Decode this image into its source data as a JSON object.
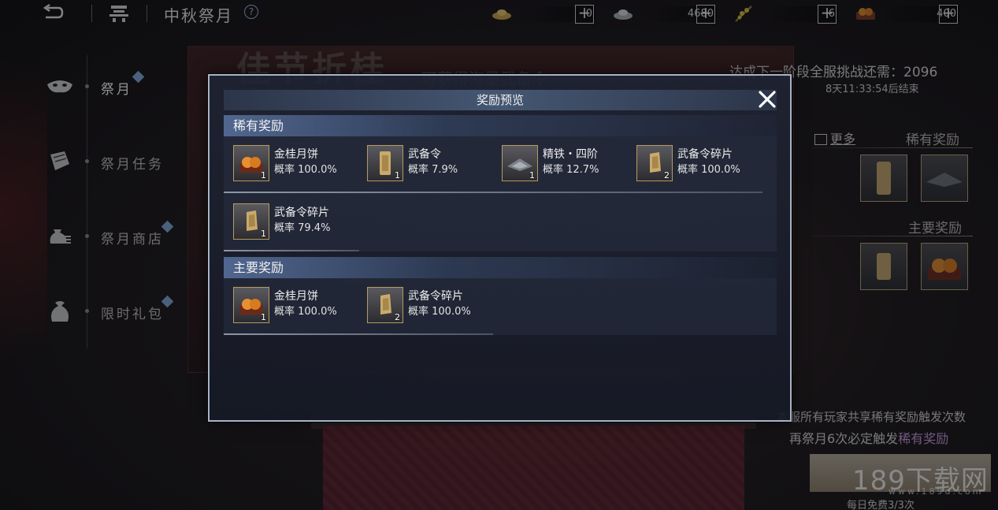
{
  "header": {
    "title": "中秋祭月",
    "currencies": [
      {
        "icon": "gold-ingot-icon",
        "value": "0"
      },
      {
        "icon": "silver-ingot-icon",
        "value": "4680"
      },
      {
        "icon": "osmanthus-branch-icon",
        "value": "6"
      },
      {
        "icon": "mooncake-currency-icon",
        "value": "400"
      }
    ]
  },
  "background": {
    "banner_title": "佳节折桂",
    "banner_sub": "可获得海量武备令"
  },
  "sidebar": {
    "items": [
      {
        "label": "祭月",
        "icon": "mask-icon",
        "active": true,
        "badge": true
      },
      {
        "label": "祭月任务",
        "icon": "scroll-icon",
        "active": false,
        "badge": false
      },
      {
        "label": "祭月商店",
        "icon": "money-bag-icon",
        "active": false,
        "badge": true
      },
      {
        "label": "限时礼包",
        "icon": "gift-bag-icon",
        "active": false,
        "badge": true
      }
    ]
  },
  "right_panel": {
    "challenge": "达成下一阶段全服挑战还需：2096",
    "countdown": "8天11:33:54后结束",
    "more": "更多",
    "rare_title": "稀有奖励",
    "main_title": "主要奖励",
    "share_text": "本服所有玩家共享稀有奖励触发次数",
    "trigger_prefix": "再祭月6次必定触发",
    "trigger_highlight": "稀有奖励",
    "daily_free": "每日免费3/3次"
  },
  "watermark": {
    "text": "189下载网",
    "url": "www.189d.com"
  },
  "modal": {
    "title": "奖励预览",
    "rare_section": {
      "title": "稀有奖励",
      "items": [
        {
          "name": "金桂月饼",
          "prob": "概率 100.0%",
          "qty": "1",
          "icon": "mooncake-icon"
        },
        {
          "name": "武备令",
          "prob": "概率 7.9%",
          "qty": "1",
          "icon": "token-icon"
        },
        {
          "name": "精铁・四阶",
          "prob": "概率 12.7%",
          "qty": "1",
          "icon": "iron-ore-icon"
        },
        {
          "name": "武备令碎片",
          "prob": "概率 100.0%",
          "qty": "2",
          "icon": "token-fragment-icon"
        },
        {
          "name": "武备令碎片",
          "prob": "概率 79.4%",
          "qty": "1",
          "icon": "token-fragment-icon"
        }
      ]
    },
    "main_section": {
      "title": "主要奖励",
      "items": [
        {
          "name": "金桂月饼",
          "prob": "概率 100.0%",
          "qty": "1",
          "icon": "mooncake-icon"
        },
        {
          "name": "武备令碎片",
          "prob": "概率 100.0%",
          "qty": "2",
          "icon": "token-fragment-icon"
        }
      ]
    }
  },
  "colors": {
    "accent_blue": "#7fa8d6",
    "highlight_purple": "#c79be0",
    "item_border": "#b59a62"
  }
}
